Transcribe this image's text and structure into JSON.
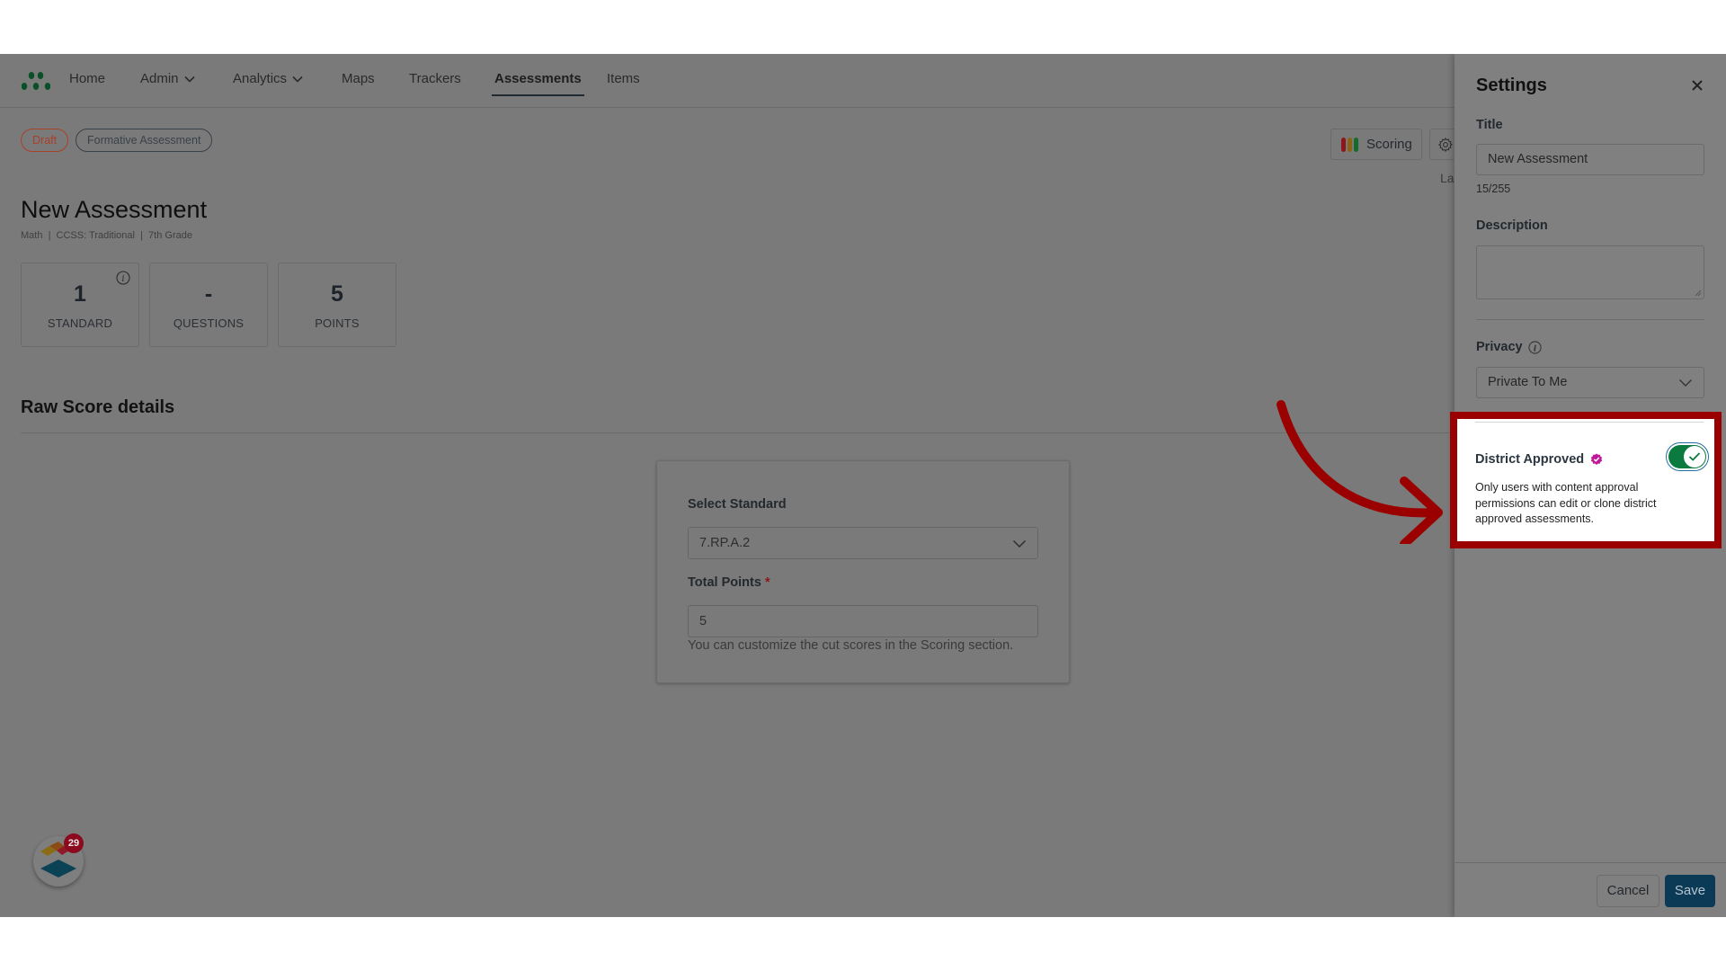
{
  "nav": {
    "items": [
      {
        "label": "Home",
        "has_dropdown": false,
        "active": false
      },
      {
        "label": "Admin",
        "has_dropdown": true,
        "active": false
      },
      {
        "label": "Analytics",
        "has_dropdown": true,
        "active": false
      },
      {
        "label": "Maps",
        "has_dropdown": false,
        "active": false
      },
      {
        "label": "Trackers",
        "has_dropdown": false,
        "active": false
      },
      {
        "label": "Assessments",
        "has_dropdown": false,
        "active": true
      },
      {
        "label": "Items",
        "has_dropdown": false,
        "active": false
      }
    ]
  },
  "badges": {
    "status": "Draft",
    "type": "Formative Assessment"
  },
  "assessment": {
    "title": "New Assessment",
    "subtitle": "Math  |  CCSS: Traditional  |  7th Grade"
  },
  "stats": [
    {
      "value": "1",
      "label": "STANDARD"
    },
    {
      "value": "-",
      "label": "QUESTIONS"
    },
    {
      "value": "5",
      "label": "POINTS"
    }
  ],
  "toolbar": {
    "scoring_label": "Scoring",
    "truncated_label": "La"
  },
  "raw_score": {
    "section_title": "Raw Score details",
    "select_standard_label": "Select Standard",
    "select_standard_value": "7.RP.A.2",
    "total_points_label": "Total Points",
    "required_mark": "*",
    "total_points_value": "5",
    "hint": "You can customize the cut scores in the Scoring section."
  },
  "settings": {
    "title": "Settings",
    "title_label": "Title",
    "title_value": "New Assessment",
    "title_count": "15/255",
    "description_label": "Description",
    "description_value": "",
    "privacy_label": "Privacy",
    "privacy_value": "Private To Me",
    "district_approved_label": "District Approved",
    "district_approved_on": true,
    "district_approved_desc": "Only users with content approval permissions can edit or clone district approved assessments.",
    "cancel_label": "Cancel",
    "save_label": "Save"
  },
  "helper": {
    "notification_count": "29"
  },
  "colors": {
    "highlight": "#9b0000",
    "toggle_on": "#0b7a3e",
    "save": "#0b3a57",
    "draft": "#a8412a",
    "verified_badge": "#c0189b"
  }
}
